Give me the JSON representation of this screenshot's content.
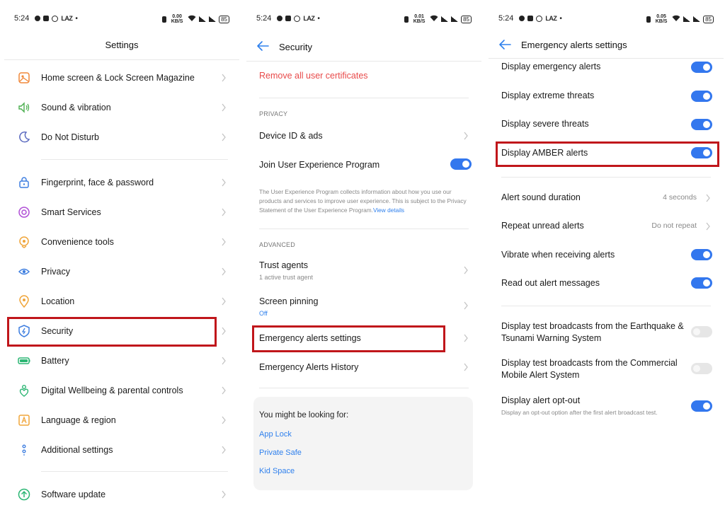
{
  "status": {
    "panel1": {
      "time": "5:24",
      "carrier_tag": "LAZ",
      "speed": "0.00 KB/S",
      "battery": "85"
    },
    "panel2": {
      "time": "5:24",
      "carrier_tag": "LAZ",
      "speed": "0.01 KB/S",
      "battery": "85"
    },
    "panel3": {
      "time": "5:24",
      "carrier_tag": "LAZ",
      "speed": "0.05 KB/S",
      "battery": "85"
    }
  },
  "settings": {
    "title": "Settings",
    "items": [
      {
        "label": "Home screen & Lock Screen Magazine",
        "icon": "home-screen-icon",
        "color": "#f0883a"
      },
      {
        "label": "Sound & vibration",
        "icon": "speaker-icon",
        "color": "#4caf50"
      },
      {
        "label": "Do Not Disturb",
        "icon": "moon-icon",
        "color": "#5c6bc0"
      },
      {
        "label": "Fingerprint, face & password",
        "icon": "lock-icon",
        "color": "#3f7fe0"
      },
      {
        "label": "Smart Services",
        "icon": "smart-services-icon",
        "color": "#b04fd6"
      },
      {
        "label": "Convenience tools",
        "icon": "tools-icon",
        "color": "#f0a53a"
      },
      {
        "label": "Privacy",
        "icon": "privacy-icon",
        "color": "#3f7fe0"
      },
      {
        "label": "Location",
        "icon": "location-icon",
        "color": "#f0a53a"
      },
      {
        "label": "Security",
        "icon": "shield-icon",
        "color": "#3f7fe0"
      },
      {
        "label": "Battery",
        "icon": "battery-icon",
        "color": "#2bb673"
      },
      {
        "label": "Digital Wellbeing & parental controls",
        "icon": "wellbeing-icon",
        "color": "#2bb673"
      },
      {
        "label": "Language & region",
        "icon": "language-icon",
        "color": "#f0a53a"
      },
      {
        "label": "Additional settings",
        "icon": "additional-settings-icon",
        "color": "#3f7fe0"
      },
      {
        "label": "Software update",
        "icon": "update-icon",
        "color": "#2bb673"
      }
    ]
  },
  "security": {
    "title": "Security",
    "remove_certs": "Remove all user certificates",
    "privacy_header": "PRIVACY",
    "device_id": "Device ID & ads",
    "join_uep": "Join User Experience Program",
    "join_uep_enabled": true,
    "uep_note": "The User Experience Program collects information about how you use our products and services to improve user experience. This is subject to the Privacy Statement of the User Experience Program.",
    "uep_link": "View details",
    "advanced_header": "ADVANCED",
    "trust_agents": "Trust agents",
    "trust_agents_sub": "1 active trust agent",
    "screen_pinning": "Screen pinning",
    "screen_pinning_sub": "Off",
    "emergency_settings": "Emergency alerts settings",
    "emergency_history": "Emergency Alerts History",
    "looking_for": "You might be looking for:",
    "suggestions": [
      "App Lock",
      "Private Safe",
      "Kid Space"
    ]
  },
  "emergency": {
    "title": "Emergency alerts settings",
    "display_emergency": "Display emergency alerts",
    "display_extreme": "Display extreme threats",
    "display_severe": "Display severe threats",
    "display_amber": "Display AMBER alerts",
    "alert_sound_duration": "Alert sound duration",
    "alert_sound_duration_value": "4 seconds",
    "repeat_unread": "Repeat unread alerts",
    "repeat_unread_value": "Do not repeat",
    "vibrate": "Vibrate when receiving alerts",
    "read_out": "Read out alert messages",
    "test_earthquake": "Display test broadcasts from the Earthquake & Tsunami Warning System",
    "test_commercial": "Display test broadcasts from the Commercial Mobile Alert System",
    "opt_out": "Display alert opt-out",
    "opt_out_sub": "Display an opt-out option after the first alert broadcast test.",
    "toggles": {
      "emergency": true,
      "extreme": true,
      "severe": true,
      "amber": true,
      "vibrate": true,
      "read_out": true,
      "earthquake": false,
      "commercial": false,
      "opt_out": true
    }
  },
  "colors": {
    "accent": "#3377ee",
    "highlight": "#c0161b",
    "warning_link": "#e84a4a"
  }
}
